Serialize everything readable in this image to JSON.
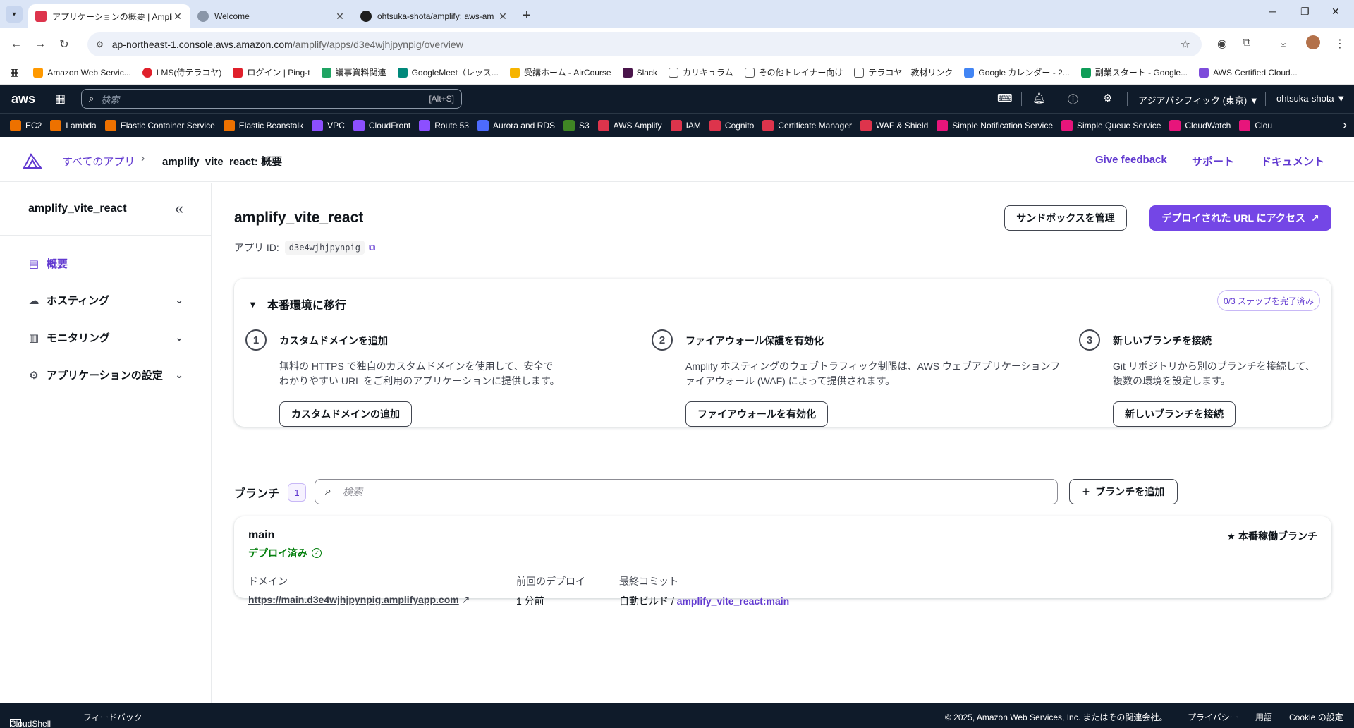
{
  "browser": {
    "tabs": [
      {
        "title": "アプリケーションの概要 | Amplify | a",
        "active": true
      },
      {
        "title": "Welcome",
        "active": false
      },
      {
        "title": "ohtsuka-shota/amplify: aws-am",
        "active": false
      }
    ],
    "url_host": "ap-northeast-1.console.aws.amazon.com",
    "url_path": "/amplify/apps/d3e4wjhjpynpig/overview",
    "bookmarks": [
      {
        "label": "Amazon Web Servic...",
        "color": "#ff9900"
      },
      {
        "label": "LMS(侍テラコヤ)",
        "color": "#e0202b"
      },
      {
        "label": "ログイン | Ping-t",
        "color": "#e0202b"
      },
      {
        "label": "議事資料関連",
        "color": "#1fa463"
      },
      {
        "label": "GoogleMeet（レッス...",
        "color": "#00897b"
      },
      {
        "label": "受講ホーム - AirCourse",
        "color": "#f6b400"
      },
      {
        "label": "Slack",
        "color": "#4a154b"
      },
      {
        "label": "カリキュラム",
        "color": "#555555"
      },
      {
        "label": "その他トレイナー向け",
        "color": "#555555"
      },
      {
        "label": "テラコヤ　教材リンク",
        "color": "#555555"
      },
      {
        "label": "Google カレンダー - 2...",
        "color": "#4285f4"
      },
      {
        "label": "副業スタート - Google...",
        "color": "#0f9d58"
      },
      {
        "label": "AWS Certified Cloud...",
        "color": "#7d4cdb"
      }
    ]
  },
  "aws": {
    "logo": "aws",
    "search_placeholder": "検索",
    "search_shortcut": "[Alt+S]",
    "region": "アジアパシフィック (東京) ▼",
    "account": "ohtsuka-shota ▼",
    "services": [
      {
        "label": "EC2",
        "color": "#ed7100"
      },
      {
        "label": "Lambda",
        "color": "#ed7100"
      },
      {
        "label": "Elastic Container Service",
        "color": "#ed7100"
      },
      {
        "label": "Elastic Beanstalk",
        "color": "#ed7100"
      },
      {
        "label": "VPC",
        "color": "#8c4fff"
      },
      {
        "label": "CloudFront",
        "color": "#8c4fff"
      },
      {
        "label": "Route 53",
        "color": "#8c4fff"
      },
      {
        "label": "Aurora and RDS",
        "color": "#4d6bfe"
      },
      {
        "label": "S3",
        "color": "#3f8624"
      },
      {
        "label": "AWS Amplify",
        "color": "#dd344c"
      },
      {
        "label": "IAM",
        "color": "#dd344c"
      },
      {
        "label": "Cognito",
        "color": "#dd344c"
      },
      {
        "label": "Certificate Manager",
        "color": "#dd344c"
      },
      {
        "label": "WAF & Shield",
        "color": "#dd344c"
      },
      {
        "label": "Simple Notification Service",
        "color": "#e7157b"
      },
      {
        "label": "Simple Queue Service",
        "color": "#e7157b"
      },
      {
        "label": "CloudWatch",
        "color": "#e7157b"
      },
      {
        "label": "Clou",
        "color": "#e7157b"
      }
    ]
  },
  "header": {
    "crumb_all": "すべてのアプリ",
    "crumb_current": "amplify_vite_react: 概要",
    "feedback": "Give feedback",
    "support": "サポート",
    "docs": "ドキュメント"
  },
  "sidebar": {
    "title": "amplify_vite_react",
    "items": [
      {
        "label": "概要",
        "active": true
      },
      {
        "label": "ホスティング"
      },
      {
        "label": "モニタリング"
      },
      {
        "label": "アプリケーションの設定"
      }
    ]
  },
  "main": {
    "title": "amplify_vite_react",
    "app_id_label": "アプリ ID:",
    "app_id": "d3e4wjhjpynpig",
    "sandbox_button": "サンドボックスを管理",
    "visit_button": "デプロイされた URL にアクセス",
    "production": {
      "title": "本番環境に移行",
      "badge": "0/3 ステップを完了済み",
      "steps": [
        {
          "num": "1",
          "title": "カスタムドメインを追加",
          "desc": "無料の HTTPS で独自のカスタムドメインを使用して、安全でわかりやすい URL をご利用のアプリケーションに提供します。",
          "button": "カスタムドメインの追加"
        },
        {
          "num": "2",
          "title": "ファイアウォール保護を有効化",
          "desc": "Amplify ホスティングのウェブトラフィック制限は、AWS ウェブアプリケーションファイアウォール (WAF) によって提供されます。",
          "button": "ファイアウォールを有効化"
        },
        {
          "num": "3",
          "title": "新しいブランチを接続",
          "desc": "Git リポジトリから別のブランチを接続して、複数の環境を設定します。",
          "button": "新しいブランチを接続"
        }
      ]
    },
    "branches": {
      "label": "ブランチ",
      "count": "1",
      "search_placeholder": "検索",
      "add_button": "ブランチを追加",
      "items": [
        {
          "name": "main",
          "status": "デプロイ済み",
          "production_badge": "本番稼働ブランチ",
          "domain_label": "ドメイン",
          "domain": "https://main.d3e4wjhjpynpig.amplifyapp.com",
          "last_deploy_label": "前回のデプロイ",
          "last_deploy": "1 分前",
          "last_commit_label": "最終コミット",
          "last_commit_prefix": "自動ビルド /",
          "last_commit_ref": "amplify_vite_react:main"
        }
      ]
    }
  },
  "footer": {
    "cloudshell": "CloudShell",
    "feedback": "フィードバック",
    "copyright": "© 2025, Amazon Web Services, Inc. またはその関連会社。",
    "privacy": "プライバシー",
    "terms": "用語",
    "cookie": "Cookie の設定"
  }
}
